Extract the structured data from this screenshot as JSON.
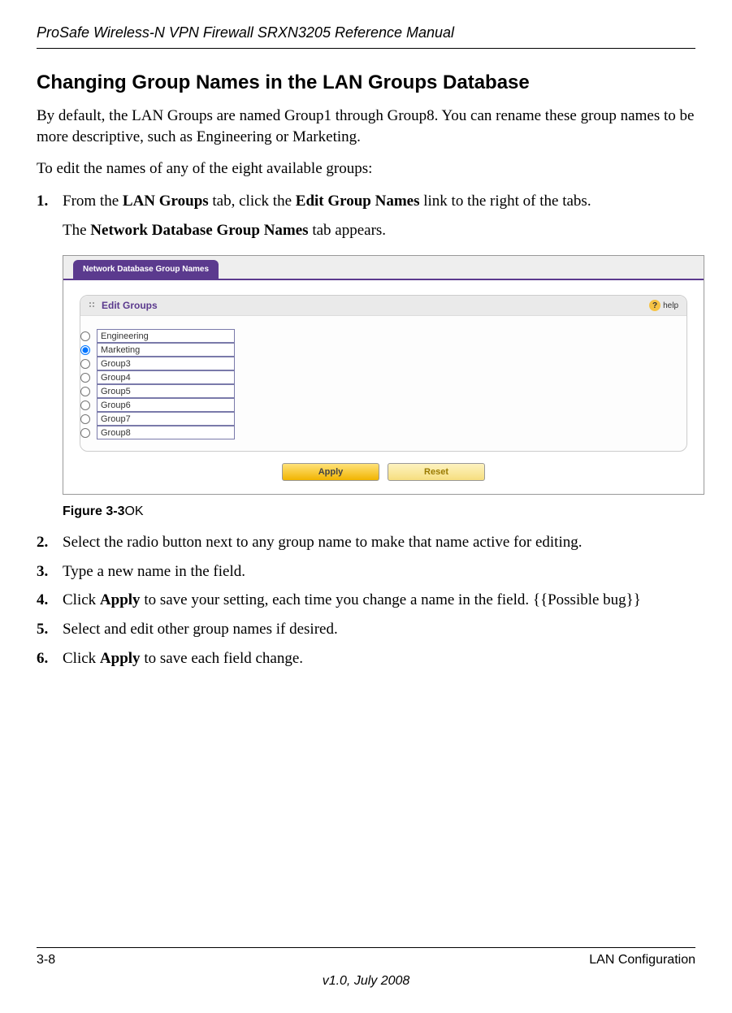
{
  "header": "ProSafe Wireless-N VPN Firewall SRXN3205 Reference Manual",
  "title": "Changing Group Names in the LAN Groups Database",
  "intro1": "By default, the LAN Groups are named Group1 through Group8. You can rename these group names to be more descriptive, such as Engineering or Marketing.",
  "intro2": "To edit the names of any of the eight available groups:",
  "step1_pre": "From the ",
  "step1_b1": "LAN Groups",
  "step1_mid": " tab, click the ",
  "step1_b2": "Edit Group Names",
  "step1_post": " link to the right of the tabs.",
  "step1_sub_pre": "The ",
  "step1_sub_b": "Network Database Group Names",
  "step1_sub_post": " tab appears.",
  "screenshot": {
    "tab": "Network Database Group Names",
    "panel_title": "Edit Groups",
    "help_text": "help",
    "groups": [
      {
        "value": "Engineering",
        "checked": false
      },
      {
        "value": "Marketing",
        "checked": true
      },
      {
        "value": "Group3",
        "checked": false
      },
      {
        "value": "Group4",
        "checked": false
      },
      {
        "value": "Group5",
        "checked": false
      },
      {
        "value": "Group6",
        "checked": false
      },
      {
        "value": "Group7",
        "checked": false
      },
      {
        "value": "Group8",
        "checked": false
      }
    ],
    "apply": "Apply",
    "reset": "Reset"
  },
  "figure_label": "Figure 3-3",
  "figure_ok": "OK",
  "step2": "Select the radio button next to any group name to make that name active for editing.",
  "step3": "Type a new name in the field.",
  "step4_pre": "Click ",
  "step4_b": "Apply",
  "step4_post": " to save your setting, each time you change a name in the field. {{Possible bug}}",
  "step5": "Select and edit other group names if desired.",
  "step6_pre": "Click ",
  "step6_b": "Apply",
  "step6_post": " to save each field change.",
  "footer_left": "3-8",
  "footer_right": "LAN Configuration",
  "footer_center": "v1.0, July 2008"
}
